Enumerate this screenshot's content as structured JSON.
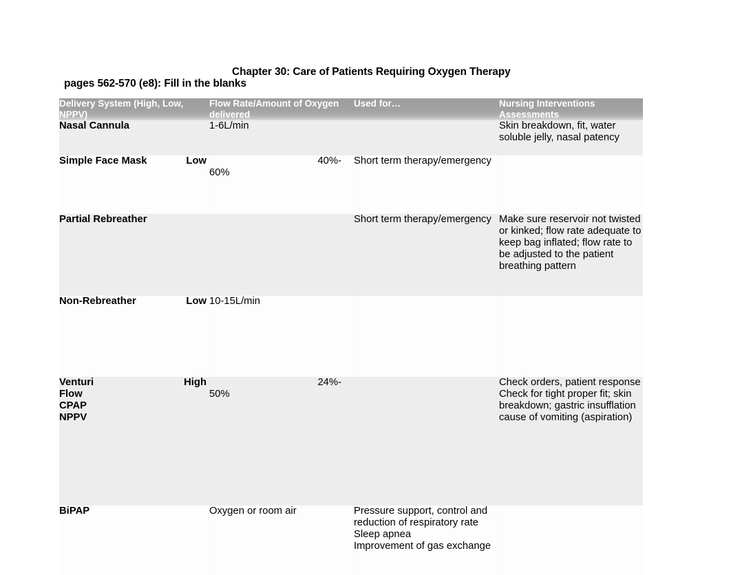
{
  "document": {
    "title": "Chapter 30: Care of Patients Requiring Oxygen Therapy",
    "subtitle": "pages 562-570 (e8): Fill in the blanks"
  },
  "table": {
    "headers": [
      "Delivery System (High, Low, NPPV)",
      "Flow Rate/Amount of Oxygen delivered",
      "Used for…",
      "Nursing Interventions Assessments"
    ],
    "rows": [
      {
        "delivery_system": "Nasal Cannula",
        "category": "",
        "flow_rate_line1": "1-6L/min",
        "flow_rate_line2": "",
        "used_for": "",
        "nursing": "Skin breakdown, fit, water soluble jelly, nasal patency"
      },
      {
        "delivery_system": "Simple Face Mask",
        "category": "Low",
        "flow_rate_line1": "40%-",
        "flow_rate_line2": "60%",
        "used_for": "Short term therapy/emergency",
        "nursing": ""
      },
      {
        "delivery_system": "Partial Rebreather",
        "category": "",
        "flow_rate_line1": "",
        "flow_rate_line2": "",
        "used_for": "Short term therapy/emergency",
        "nursing": "Make sure reservoir not twisted or kinked; flow rate adequate to keep bag inflated; flow rate to be adjusted to the patient breathing pattern"
      },
      {
        "delivery_system": "Non-Rebreather",
        "category": "Low",
        "flow_rate_line1": "10-15L/min",
        "flow_rate_line2": "",
        "used_for": "",
        "nursing": ""
      },
      {
        "delivery_system": "Venturi",
        "delivery_system_extra": [
          "Flow",
          "CPAP",
          "NPPV"
        ],
        "category": "High",
        "flow_rate_line1": "24%-",
        "flow_rate_line2": "50%",
        "used_for": "",
        "nursing_line1": "Check orders, patient response",
        "nursing_line2": "Check for tight proper fit; skin breakdown; gastric insufflation cause of vomiting (aspiration)"
      },
      {
        "delivery_system": "BiPAP",
        "category": "",
        "flow_rate_line1": "Oxygen or room air",
        "flow_rate_line2": "",
        "used_for_lines": [
          "Pressure support, control and reduction of respiratory rate",
          "Sleep apnea",
          "Improvement of gas exchange"
        ],
        "nursing": ""
      }
    ]
  },
  "colors": {
    "header_background": "#a0a0a0",
    "header_text": "#ffffff",
    "row_shade": "#ededed",
    "row_plain": "#fdfdfd",
    "body_text": "#000000"
  }
}
